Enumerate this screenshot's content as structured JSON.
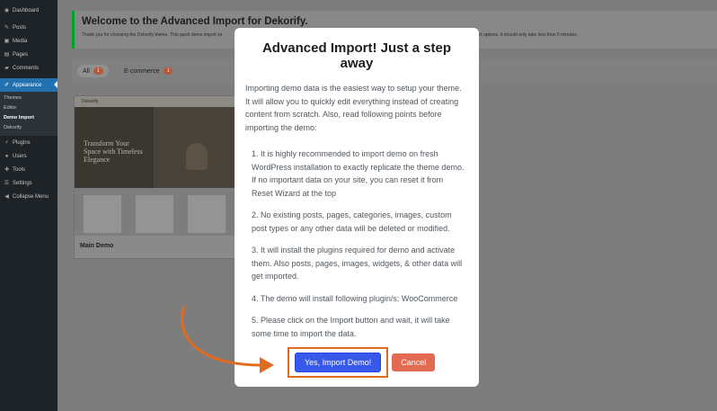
{
  "sidebar": {
    "items": [
      {
        "label": "Dashboard",
        "icon": "dashboard-icon"
      },
      {
        "label": "Posts",
        "icon": "pin-icon"
      },
      {
        "label": "Media",
        "icon": "media-icon"
      },
      {
        "label": "Pages",
        "icon": "page-icon"
      },
      {
        "label": "Comments",
        "icon": "comment-icon"
      },
      {
        "label": "Appearance",
        "icon": "brush-icon"
      }
    ],
    "submenu": [
      "Themes",
      "Editor",
      "Demo Import",
      "Dekorify"
    ],
    "items_after": [
      {
        "label": "Plugins",
        "icon": "plug-icon"
      },
      {
        "label": "Users",
        "icon": "user-icon"
      },
      {
        "label": "Tools",
        "icon": "wrench-icon"
      },
      {
        "label": "Settings",
        "icon": "settings-icon"
      },
      {
        "label": "Collapse Menu",
        "icon": "collapse-icon"
      }
    ]
  },
  "welcome": {
    "title": "Welcome to the Advanced Import for Dekorify.",
    "text_left": "Thank you for choosing the Dekorify theme. This quick demo import se",
    "text_right": "and tell you a little about Help & Support options. It should only take less than 5 minutes."
  },
  "filters": {
    "all": {
      "label": "All",
      "count": "1"
    },
    "ecommerce": {
      "label": "E-commerce",
      "count": "1"
    }
  },
  "demo": {
    "title": "Main Demo",
    "preview_brand": "Dekorify",
    "preview_headline": "Transform Your Space with Timeless Elegance"
  },
  "modal": {
    "title": "Advanced Import! Just a step away",
    "intro": "Importing demo data is the easiest way to setup your theme. It will allow you to quickly edit everything instead of creating content from scratch. Also, read following points before importing the demo:",
    "points": [
      "1. It is highly recommended to import demo on fresh WordPress installation to exactly replicate the theme demo. If no important data on your site, you can reset it from Reset Wizard at the top",
      "2. No existing posts, pages, categories, images, custom post types or any other data will be deleted or modified.",
      "3. It will install the plugins required for demo and activate them. Also posts, pages, images, widgets, & other data will get imported.",
      "4. The demo will install following plugin/s: WooCommerce",
      "5. Please click on the Import button and wait, it will take some time to import the data."
    ],
    "confirm_label": "Yes, Import Demo!",
    "cancel_label": "Cancel"
  },
  "colors": {
    "accent": "#3858e9",
    "cancel": "#e26a50",
    "annotation": "#e06a1e"
  }
}
